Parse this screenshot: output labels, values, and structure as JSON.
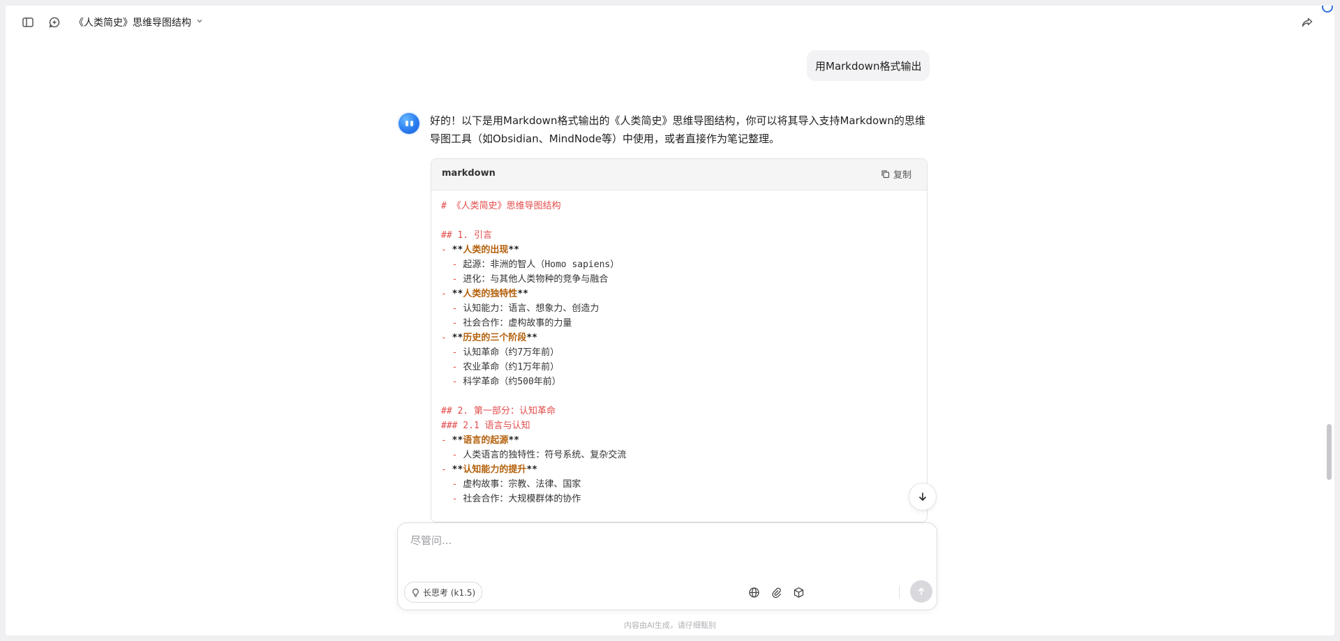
{
  "header": {
    "title": "《人类简史》思维导图结构",
    "sidebar_icon": "sidebar-toggle-icon",
    "new_chat_icon": "new-chat-icon",
    "share_icon": "share-icon"
  },
  "conversation": {
    "user_message": "用Markdown格式输出",
    "ai_intro": "好的！以下是用Markdown格式输出的《人类简史》思维导图结构，你可以将其导入支持Markdown的思维导图工具（如Obsidian、MindNode等）中使用，或者直接作为笔记整理。",
    "code_block": {
      "language": "markdown",
      "copy_label": "复制",
      "lines": [
        {
          "parts": [
            {
              "t": "# 《人类简史》思维导图结构",
              "s": "red"
            }
          ]
        },
        {
          "parts": []
        },
        {
          "parts": [
            {
              "t": "## 1. 引言",
              "s": "red"
            }
          ]
        },
        {
          "parts": [
            {
              "t": "- ",
              "s": "red"
            },
            {
              "t": "**",
              "s": "dark"
            },
            {
              "t": "人类的出现",
              "s": "bold"
            },
            {
              "t": "**",
              "s": "dark"
            }
          ]
        },
        {
          "parts": [
            {
              "t": "  - ",
              "s": "red"
            },
            {
              "t": "起源：非洲的智人（Homo sapiens）",
              "s": "plain"
            }
          ]
        },
        {
          "parts": [
            {
              "t": "  - ",
              "s": "red"
            },
            {
              "t": "进化：与其他人类物种的竞争与融合",
              "s": "plain"
            }
          ]
        },
        {
          "parts": [
            {
              "t": "- ",
              "s": "red"
            },
            {
              "t": "**",
              "s": "dark"
            },
            {
              "t": "人类的独特性",
              "s": "bold"
            },
            {
              "t": "**",
              "s": "dark"
            }
          ]
        },
        {
          "parts": [
            {
              "t": "  - ",
              "s": "red"
            },
            {
              "t": "认知能力：语言、想象力、创造力",
              "s": "plain"
            }
          ]
        },
        {
          "parts": [
            {
              "t": "  - ",
              "s": "red"
            },
            {
              "t": "社会合作：虚构故事的力量",
              "s": "plain"
            }
          ]
        },
        {
          "parts": [
            {
              "t": "- ",
              "s": "red"
            },
            {
              "t": "**",
              "s": "dark"
            },
            {
              "t": "历史的三个阶段",
              "s": "bold"
            },
            {
              "t": "**",
              "s": "dark"
            }
          ]
        },
        {
          "parts": [
            {
              "t": "  - ",
              "s": "red"
            },
            {
              "t": "认知革命（约7万年前）",
              "s": "plain"
            }
          ]
        },
        {
          "parts": [
            {
              "t": "  - ",
              "s": "red"
            },
            {
              "t": "农业革命（约1万年前）",
              "s": "plain"
            }
          ]
        },
        {
          "parts": [
            {
              "t": "  - ",
              "s": "red"
            },
            {
              "t": "科学革命（约500年前）",
              "s": "plain"
            }
          ]
        },
        {
          "parts": []
        },
        {
          "parts": [
            {
              "t": "## 2. 第一部分：认知革命",
              "s": "red"
            }
          ]
        },
        {
          "parts": [
            {
              "t": "### 2.1 语言与认知",
              "s": "red"
            }
          ]
        },
        {
          "parts": [
            {
              "t": "- ",
              "s": "red"
            },
            {
              "t": "**",
              "s": "dark"
            },
            {
              "t": "语言的起源",
              "s": "bold"
            },
            {
              "t": "**",
              "s": "dark"
            }
          ]
        },
        {
          "parts": [
            {
              "t": "  - ",
              "s": "red"
            },
            {
              "t": "人类语言的独特性：符号系统、复杂交流",
              "s": "plain"
            }
          ]
        },
        {
          "parts": [
            {
              "t": "- ",
              "s": "red"
            },
            {
              "t": "**",
              "s": "dark"
            },
            {
              "t": "认知能力的提升",
              "s": "bold"
            },
            {
              "t": "**",
              "s": "dark"
            }
          ]
        },
        {
          "parts": [
            {
              "t": "  - ",
              "s": "red"
            },
            {
              "t": "虚构故事：宗教、法律、国家",
              "s": "plain"
            }
          ]
        },
        {
          "parts": [
            {
              "t": "  - ",
              "s": "red"
            },
            {
              "t": "社会合作：大规模群体的协作",
              "s": "plain"
            }
          ]
        }
      ]
    }
  },
  "composer": {
    "placeholder": "尽管问...",
    "think_label": "长思考 (k1.5)",
    "disclaimer": "内容由AI生成，请仔细甄别"
  },
  "colors": {
    "accent": "#2b7df0",
    "code_red": "#e34b4b",
    "code_bold": "#b4610c"
  }
}
